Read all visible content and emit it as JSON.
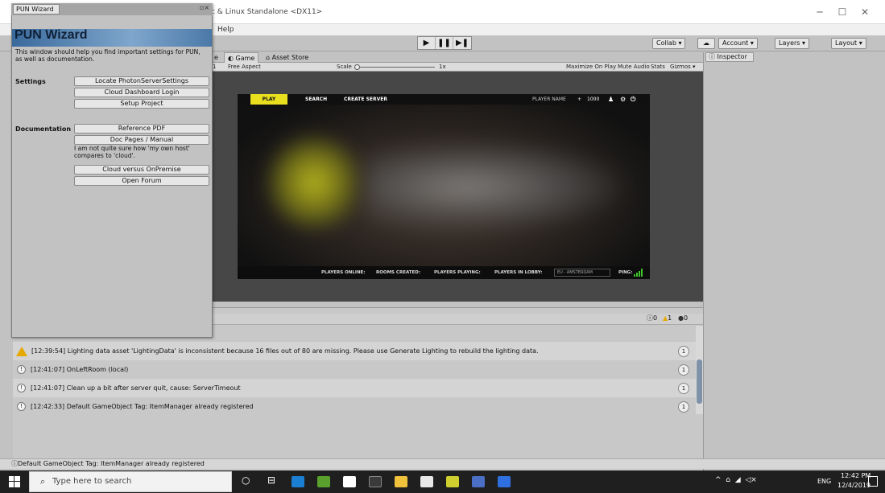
{
  "window": {
    "title": "c & Linux Standalone <DX11>",
    "menu_help": "Help",
    "minimize": "─",
    "maximize": "☐",
    "close": "✕"
  },
  "toolbar": {
    "play": "▶",
    "pause": "❚❚",
    "step": "▶❚",
    "collab": "Collab ▾",
    "cloud": "☁",
    "account": "Account ▾",
    "layers": "Layers ▾",
    "layout": "Layout ▾"
  },
  "game_view": {
    "tab_prev": "e",
    "tab_game": "Game",
    "tab_asset_store": "Asset Store",
    "display_num": "1",
    "aspect": "Free Aspect",
    "scale_label": "Scale",
    "scale_value": "1x",
    "maximize_on_play": "Maximize On Play",
    "mute_audio": "Mute Audio",
    "stats": "Stats",
    "gizmos": "Gizmos ▾"
  },
  "game": {
    "tab_play": "PLAY",
    "tab_search": "SEARCH",
    "tab_create_server": "CREATE SERVER",
    "player_name": "PLAYER NAME",
    "coins": "1000",
    "players_online": "PLAYERS ONLINE:",
    "rooms_created": "ROOMS CREATED:",
    "players_playing": "PLAYERS PLAYING:",
    "players_in_lobby": "PLAYERS IN LOBBY:",
    "region": "EU - AMSTERDAM",
    "ping": "PING:"
  },
  "inspector": {
    "tab": "Inspector"
  },
  "console": {
    "count_info": "0",
    "count_warn": "1",
    "count_error": "0",
    "rows": [
      {
        "text": "[12:39:54] Lighting data asset 'LightingData' is inconsistent because 16 files out of 80 are missing.  Please use Generate Lighting to rebuild the lighting data.",
        "count": "1"
      },
      {
        "text": "[12:41:07] OnLeftRoom (local)",
        "count": "1"
      },
      {
        "text": "[12:41:07] Clean up a bit after server quit, cause: ServerTimeout",
        "count": "1"
      },
      {
        "text": "[12:42:33] Default GameObject Tag: ItemManager already registered",
        "count": "1"
      }
    ]
  },
  "status": {
    "text": "Default GameObject Tag: ItemManager already registered"
  },
  "pun_wizard": {
    "tab": "PUN Wizard",
    "title": "PUN Wizard",
    "description": "This window should help you find important settings for PUN, as well as documentation.",
    "settings_label": "Settings",
    "btn_locate": "Locate PhotonServerSettings",
    "btn_cloud_dashboard": "Cloud Dashboard Login",
    "btn_setup": "Setup Project",
    "documentation_label": "Documentation",
    "btn_reference_pdf": "Reference PDF",
    "btn_doc_pages": "Doc Pages / Manual",
    "note": "I am not quite sure how 'my own host' compares to 'cloud'.",
    "btn_cloud_vs_onpremise": "Cloud versus OnPremise",
    "btn_open_forum": "Open Forum"
  },
  "taskbar": {
    "search_placeholder": "Type here to search",
    "lang": "ENG",
    "time": "12:42 PM",
    "date": "12/4/2019"
  },
  "colors": {
    "accent_yellow": "#e9df1e",
    "pun_header_blue": "#3a6a9c",
    "warning": "#e5a900"
  }
}
